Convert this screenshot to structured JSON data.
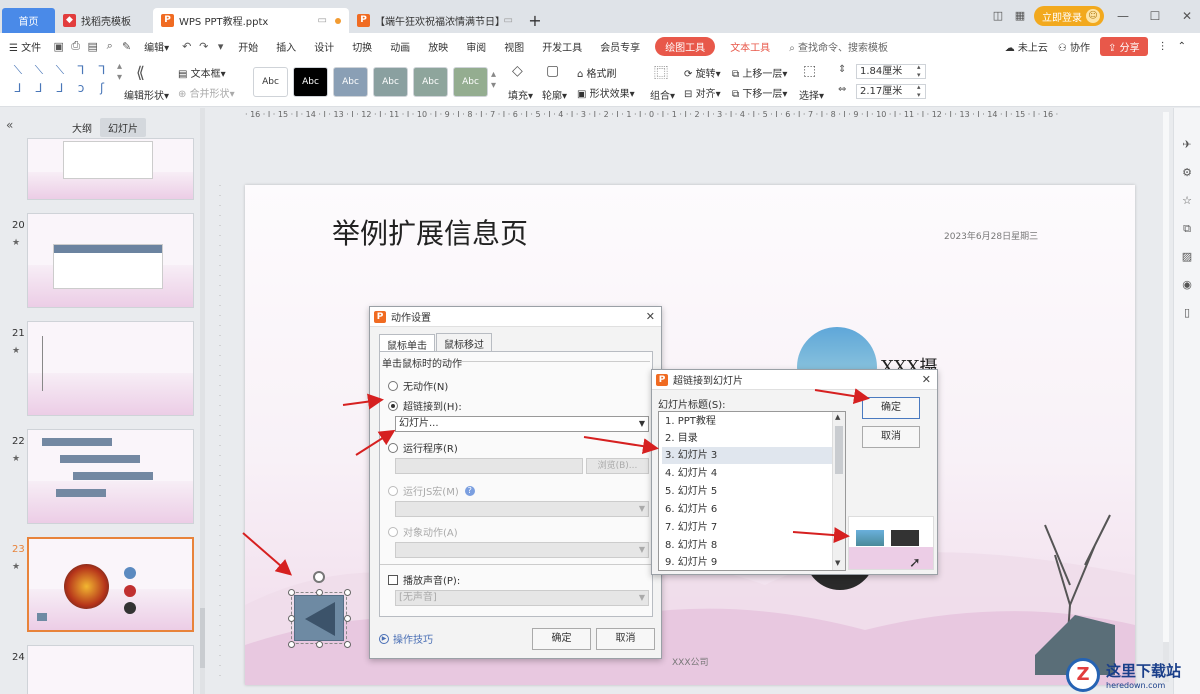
{
  "tabs": {
    "home": "首页",
    "template": "找稻壳模板",
    "doc": "WPS PPT教程.pptx",
    "doc2": "【端午狂欢祝福浓情满节日】",
    "new": "+"
  },
  "titlebar": {
    "login": "立即登录"
  },
  "menu": {
    "file": "文件",
    "edit": "编辑",
    "items": [
      "开始",
      "插入",
      "设计",
      "切换",
      "动画",
      "放映",
      "审阅",
      "视图",
      "开发工具",
      "会员专享"
    ],
    "drawing_tools": "绘图工具",
    "text_tools": "文本工具",
    "search": "查找命令、搜索模板",
    "cloud": "未上云",
    "collab": "协作",
    "share": "分享"
  },
  "ribbon": {
    "edit_shape": "编辑形状",
    "textbox": "文本框",
    "merge_shape": "合并形状",
    "styles": [
      "Abc",
      "Abc",
      "Abc",
      "Abc",
      "Abc",
      "Abc"
    ],
    "style_colors": [
      "#ffffff",
      "#000000",
      "#8a9fb5",
      "#8aa0a0",
      "#8ea59c",
      "#94ad90"
    ],
    "fill": "填充",
    "outline": "轮廓",
    "format_painter": "格式刷",
    "shape_effects": "形状效果",
    "group": "组合",
    "rotate": "旋转",
    "align": "对齐",
    "bring_forward": "上移一层",
    "send_backward": "下移一层",
    "select": "选择",
    "height": "1.84厘米",
    "width": "2.17厘米"
  },
  "left_panel": {
    "tab_outline": "大纲",
    "tab_slides": "幻灯片",
    "slide_numbers": [
      "20",
      "21",
      "22",
      "23",
      "24"
    ],
    "star": "★"
  },
  "ruler": {
    "horizontal": "· 16 · I · 15 · I · 14 · I · 13 · I · 12 · I · 11 · I · 10 · I · 9 · I · 8 · I · 7 · I · 6 · I · 5 · I · 4 · I · 3 · I · 2 · I · 1 · I · 0 · I · 1 · I · 2 · I · 3 · I · 4 · I · 5 · I · 6 · I · 7 · I · 8 · I · 9 · I · 10 · I · 11 · I · 12 · I · 13 · I · 14 · I · 15 · I · 16 ·"
  },
  "slide": {
    "title": "举例扩展信息页",
    "date": "2023年6月28日星期三",
    "heading1": "XXX摄",
    "heading2": "",
    "company": "XXX公司"
  },
  "action_dialog": {
    "title": "动作设置",
    "tab_click": "鼠标单击",
    "tab_hover": "鼠标移过",
    "section": "单击鼠标时的动作",
    "none": "无动作(N)",
    "hyperlink": "超链接到(H):",
    "hyperlink_value": "幻灯片...",
    "run_program": "运行程序(R)",
    "browse": "浏览(B)...",
    "run_js": "运行JS宏(M)",
    "object_action": "对象动作(A)",
    "play_sound": "播放声音(P):",
    "sound_value": "[无声音]",
    "tips": "操作技巧",
    "ok": "确定",
    "cancel": "取消"
  },
  "link_dialog": {
    "title": "超链接到幻灯片",
    "list_label": "幻灯片标题(S):",
    "items": [
      "1. PPT教程",
      "2. 目录",
      "3. 幻灯片 3",
      "4. 幻灯片 4",
      "5. 幻灯片 5",
      "6. 幻灯片 6",
      "7. 幻灯片 7",
      "8. 幻灯片 8",
      "9. 幻灯片 9"
    ],
    "selected_index": 2,
    "ok": "确定",
    "cancel": "取消"
  },
  "watermark": {
    "logo": "Z",
    "cn": "这里下载站",
    "en": "heredown.com"
  },
  "colors": {
    "accent": "#e8584a",
    "tab_home": "#4a8ae8",
    "login": "#f2a91e",
    "arrow": "#d62020"
  }
}
